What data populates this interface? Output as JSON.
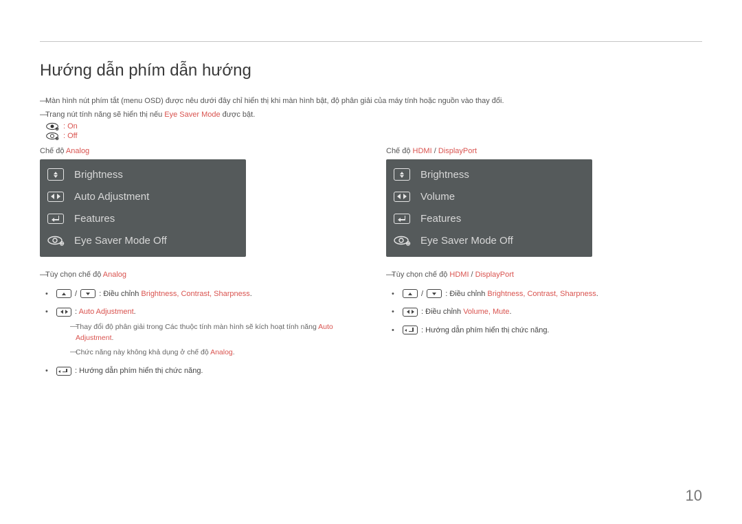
{
  "page": {
    "title": "Hướng dẫn phím dẫn hướng",
    "note1_pre": "Màn hình nút phím tắt (menu OSD) được nêu dưới đây chỉ hiển thị khi màn hình bật, độ phân giải của máy tính hoặc nguồn vào thay đổi.",
    "note2_pre": "Trang nút tính năng sẽ hiển thị nếu ",
    "note2_hl": "Eye Saver Mode",
    "note2_post": " được bật.",
    "eye_on": ": On",
    "eye_off": ": Off",
    "mode_label_prefix": "Chế độ ",
    "analog": "Analog",
    "hdmi": "HDMI",
    "dp": "DisplayPort",
    "slash": " / ",
    "page_number": "10"
  },
  "osd": {
    "brightness": "Brightness",
    "auto_adjustment": "Auto Adjustment",
    "features": "Features",
    "eye_saver_off": "Eye Saver Mode Off",
    "volume": "Volume"
  },
  "left": {
    "opt_prefix": "Tùy chọn chế độ ",
    "opt_hl": "Analog",
    "b1_pre": " : Điều chỉnh ",
    "b1_items": "Brightness, Contrast, Sharpness",
    "b1_post": ".",
    "b2_pre": " : ",
    "b2_hl": "Auto Adjustment",
    "b2_post": ".",
    "b2_sub1_pre": "Thay đổi độ phân giải trong Các thuộc tính màn hình sẽ kích hoạt tính năng ",
    "b2_sub1_hl": "Auto Adjustment",
    "b2_sub1_post": ".",
    "b2_sub2_pre": "Chức năng này không khả dụng ở chế độ ",
    "b2_sub2_hl": "Analog",
    "b2_sub2_post": ".",
    "b3": " : Hướng dẫn phím hiển thị chức năng."
  },
  "right": {
    "opt_prefix": "Tùy chọn chế độ ",
    "b1_pre": " : Điều chỉnh ",
    "b1_items": "Brightness, Contrast, Sharpness",
    "b1_post": ".",
    "b2_pre": " : Điều chỉnh ",
    "b2_items": "Volume, Mute",
    "b2_post": ".",
    "b3": " : Hướng dẫn phím hiển thị chức năng."
  }
}
